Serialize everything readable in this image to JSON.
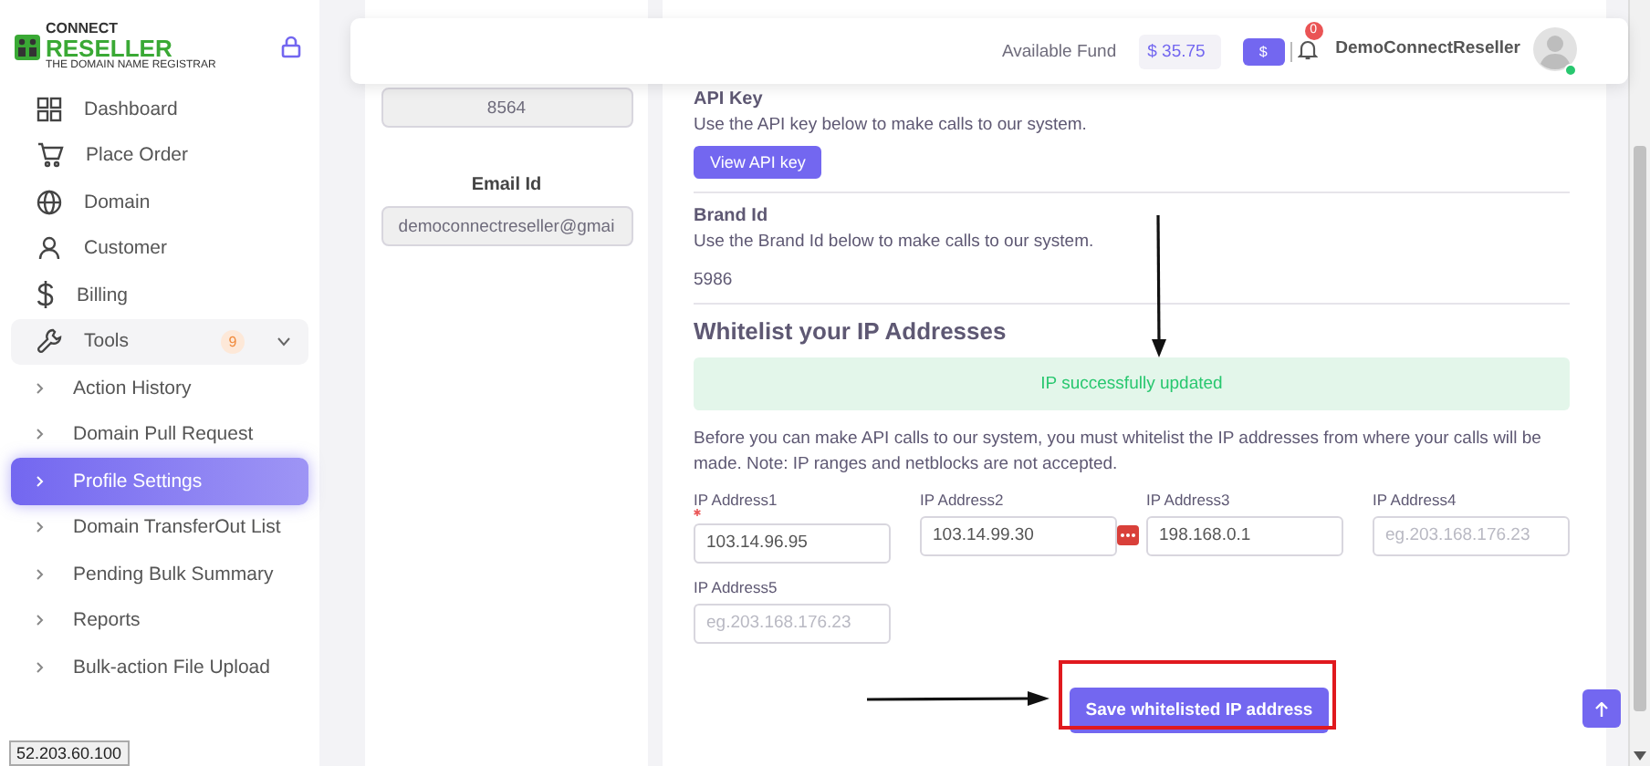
{
  "sidebar": {
    "logo": {
      "line1": "CONNECT",
      "line2": "RESELLER",
      "tagline": "THE DOMAIN NAME REGISTRAR"
    },
    "items": [
      {
        "label": "Dashboard",
        "selected": false
      },
      {
        "label": "Place Order",
        "selected": false
      },
      {
        "label": "Domain",
        "selected": false
      },
      {
        "label": "Customer",
        "selected": false
      },
      {
        "label": "Billing",
        "selected": false
      },
      {
        "label": "Tools",
        "selected": false,
        "badge": "9",
        "expanded": true,
        "children": [
          {
            "label": "Action History",
            "selected": false
          },
          {
            "label": "Domain Pull Request",
            "selected": false
          },
          {
            "label": "Profile Settings",
            "selected": true
          },
          {
            "label": "Domain TransferOut List",
            "selected": false
          },
          {
            "label": "Pending Bulk Summary",
            "selected": false
          },
          {
            "label": "Reports",
            "selected": false
          },
          {
            "label": "Bulk-action File Upload",
            "selected": false
          }
        ]
      }
    ]
  },
  "top_bar": {
    "fund_label": "Available Fund",
    "fund": "$ 35.75",
    "currency_button": "$",
    "notifications": "0",
    "user": "DemoConnectReseller",
    "online": true
  },
  "profile_card": {
    "fields": [
      {
        "value": "8564"
      },
      {
        "label": "Email Id",
        "value": "democonnectreseller@gmai"
      }
    ]
  },
  "api_key": {
    "heading": "API Key",
    "text": "Use the API key below to make calls to our system.",
    "button": "View API key"
  },
  "brand_id": {
    "heading": "Brand Id",
    "text": "Use the Brand Id below to make calls to our system.",
    "value": "5986"
  },
  "whitelist": {
    "title": "Whitelist your IP Addresses",
    "alert": "IP successfully updated",
    "note": "Before you can make API calls to our system, you must whitelist the IP addresses from where your calls will be made. Note: IP ranges and netblocks are not accepted.",
    "fields": [
      {
        "label": "IP Address1",
        "required": true,
        "value": "103.14.96.95"
      },
      {
        "label": "IP Address2",
        "required": false,
        "value": "103.14.99.30"
      },
      {
        "label": "IP Address3",
        "required": false,
        "value": "198.168.0.1"
      },
      {
        "label": "IP Address4",
        "required": false,
        "placeholder": "eg.203.168.176.23"
      },
      {
        "label": "IP Address5",
        "required": false,
        "placeholder": "eg.203.168.176.23"
      }
    ],
    "save_button": "Save whitelisted IP address"
  },
  "status_url": "52.203.60.100"
}
